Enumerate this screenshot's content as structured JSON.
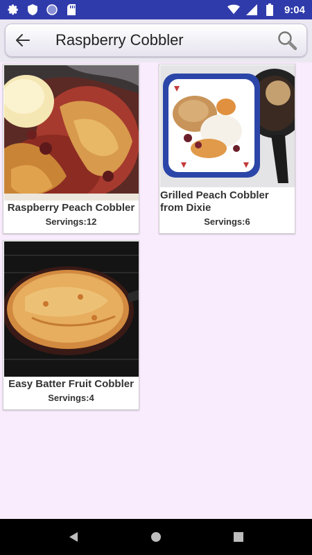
{
  "status_bar": {
    "time": "9:04",
    "icons": [
      "settings-icon",
      "shield-icon",
      "circle-icon",
      "sd-card-icon",
      "wifi-icon",
      "signal-icon",
      "battery-icon"
    ]
  },
  "search": {
    "query": "Raspberry Cobbler",
    "back_icon": "arrow-left-icon",
    "search_icon": "magnifier-icon"
  },
  "recipes": [
    {
      "title": "Raspberry Peach Cobbler",
      "servings": "Servings:12",
      "image": "raspberry-peach-cobbler-photo"
    },
    {
      "title": "Grilled Peach Cobbler from Dixie",
      "servings": "Servings:6",
      "image": "grilled-peach-cobbler-photo"
    },
    {
      "title": "Easy Batter Fruit Cobbler",
      "servings": "Servings:4",
      "image": "easy-batter-fruit-cobbler-photo"
    }
  ],
  "nav": {
    "back": "back-triangle-icon",
    "home": "home-circle-icon",
    "recents": "recents-square-icon"
  },
  "colors": {
    "status_bar": "#2f3bab",
    "background": "#f9ecfd",
    "nav_bar": "#000000"
  }
}
